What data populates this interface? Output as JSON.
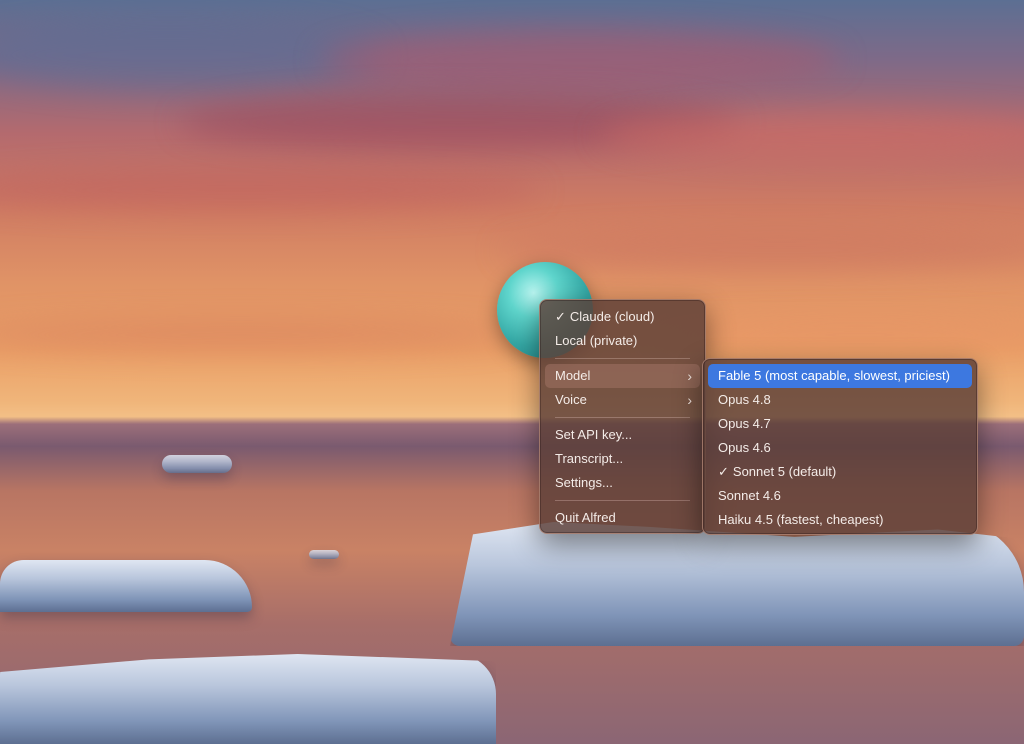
{
  "main_menu": {
    "items": [
      {
        "label": "Claude (cloud)",
        "checked": true
      },
      {
        "label": "Local (private)",
        "checked": false
      }
    ],
    "model_label": "Model",
    "voice_label": "Voice",
    "actions": [
      {
        "label": "Set API key..."
      },
      {
        "label": "Transcript..."
      },
      {
        "label": "Settings..."
      }
    ],
    "quit_label": "Quit Alfred",
    "submenu_arrow": "›",
    "check_glyph": "✓"
  },
  "model_submenu": {
    "items": [
      {
        "label": "Fable 5 (most capable, slowest, priciest)",
        "checked": false,
        "highlighted": true
      },
      {
        "label": "Opus 4.8",
        "checked": false
      },
      {
        "label": "Opus 4.7",
        "checked": false
      },
      {
        "label": "Opus 4.6",
        "checked": false
      },
      {
        "label": "Sonnet 5 (default)",
        "checked": true
      },
      {
        "label": "Sonnet 4.6",
        "checked": false
      },
      {
        "label": "Haiku 4.5 (fastest, cheapest)",
        "checked": false
      }
    ]
  },
  "colors": {
    "highlight": "#3d78e0",
    "orb": "#4cc4bd"
  },
  "icons": {
    "orb": "assistant-orb-icon",
    "chevron": "chevron-right-icon",
    "check": "checkmark-icon"
  }
}
